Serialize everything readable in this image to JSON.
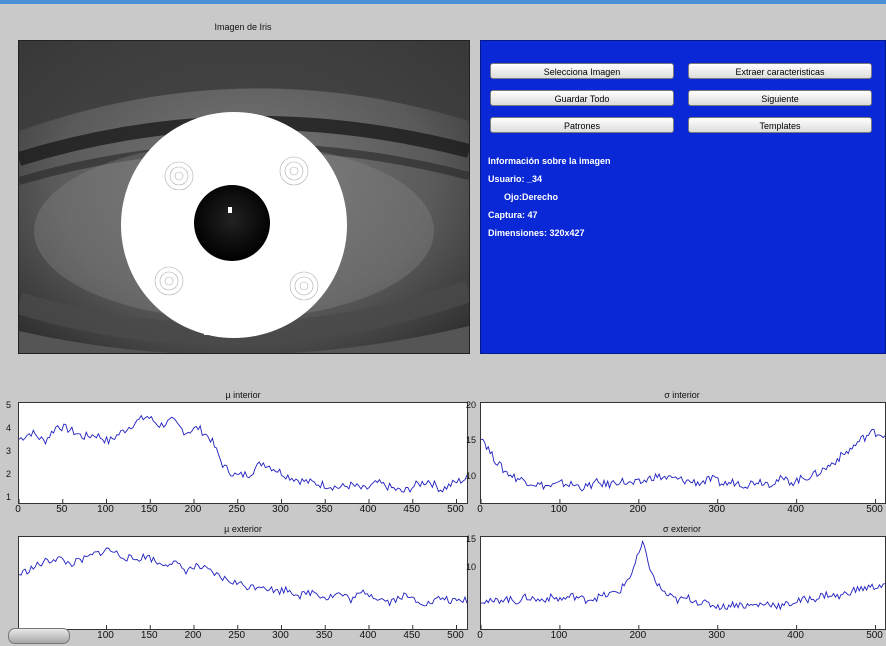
{
  "window": {
    "accent": "#4a90d9"
  },
  "eye_panel": {
    "title": "Imagen de Iris"
  },
  "buttons": {
    "select_image": "Selecciona Imagen",
    "extract_features": "Extraer caracteristicas",
    "save_all": "Guardar Todo",
    "next": "Siguiente",
    "patterns": "Patrones",
    "templates": "Templates"
  },
  "info": {
    "heading": "Información sobre la imagen",
    "user": "Usuario: _34",
    "eye": "Ojo:Derecho",
    "capture": "Captura: 47",
    "dimensions": "Dimensiones: 320x427",
    "background_color": "#0a28d6"
  },
  "chart_data": [
    {
      "type": "line",
      "title": "µ interior",
      "xlim": [
        0,
        512
      ],
      "x_ticks": [
        "0",
        "50",
        "100",
        "150",
        "200",
        "250",
        "300",
        "350",
        "400",
        "450",
        "500"
      ],
      "y_ticks": [
        "5",
        "4",
        "3",
        "2",
        "1"
      ],
      "series": [
        {
          "values": [
            3.6,
            3.9,
            3.5,
            4.2,
            4.0,
            3.7,
            3.8,
            3.5,
            3.9,
            4.3,
            4.6,
            4.2,
            4.4,
            3.9,
            4.1,
            3.6,
            2.4,
            2.0,
            2.1,
            2.6,
            2.3,
            2.0,
            1.8,
            1.7,
            1.6,
            1.5,
            1.6,
            1.4,
            1.7,
            1.5,
            1.3,
            1.6,
            1.8,
            1.4,
            1.7,
            1.9
          ]
        }
      ],
      "color": "#2020c0"
    },
    {
      "type": "line",
      "title": "σ interior",
      "xlim": [
        0,
        512
      ],
      "x_ticks": [
        "0",
        "100",
        "200",
        "300",
        "400",
        "500"
      ],
      "y_ticks": [
        "20",
        "15",
        "10"
      ],
      "series": [
        {
          "values": [
            16,
            13,
            11,
            10,
            9.5,
            9.0,
            8.8,
            9.2,
            9.0,
            8.6,
            9.3,
            9.0,
            9.6,
            9.1,
            9.4,
            10.2,
            10.0,
            9.8,
            9.5,
            9.3,
            9.8,
            9.1,
            9.4,
            9.0,
            9.6,
            9.2,
            9.8,
            9.4,
            10.0,
            10.5,
            11.5,
            12.8,
            14.0,
            15.5,
            16.5,
            16.0
          ]
        }
      ],
      "color": "#2020c0"
    },
    {
      "type": "line",
      "title": "µ exterior",
      "xlim": [
        0,
        512
      ],
      "x_ticks": [
        "100",
        "150",
        "200",
        "250",
        "300",
        "350",
        "400",
        "450",
        "500"
      ],
      "y_ticks": [],
      "series": [
        {
          "values": [
            3.4,
            3.7,
            4.0,
            4.2,
            3.9,
            4.1,
            4.4,
            4.6,
            4.3,
            4.1,
            4.3,
            3.9,
            4.0,
            3.6,
            3.8,
            3.5,
            3.2,
            3.0,
            2.8,
            2.9,
            2.6,
            2.7,
            2.4,
            2.6,
            2.3,
            2.5,
            2.2,
            2.6,
            2.3,
            2.1,
            2.4,
            2.2,
            2.0,
            2.3,
            2.1,
            2.2
          ]
        }
      ],
      "color": "#2020c0"
    },
    {
      "type": "line",
      "title": "σ exterior",
      "xlim": [
        0,
        512
      ],
      "x_ticks": [
        "0",
        "100",
        "200",
        "300",
        "400",
        "500"
      ],
      "y_ticks": [
        "15",
        "10"
      ],
      "series": [
        {
          "values": [
            4.5,
            4.0,
            4.8,
            4.2,
            5.0,
            4.4,
            4.9,
            4.6,
            5.2,
            4.5,
            4.9,
            5.4,
            6.0,
            9.0,
            14.5,
            8.0,
            5.5,
            4.4,
            4.8,
            4.0,
            3.6,
            3.2,
            3.8,
            3.4,
            3.6,
            3.9,
            3.3,
            4.0,
            4.5,
            4.8,
            5.5,
            5.0,
            6.0,
            6.5,
            6.8,
            7.2
          ]
        }
      ],
      "color": "#2020c0"
    }
  ]
}
